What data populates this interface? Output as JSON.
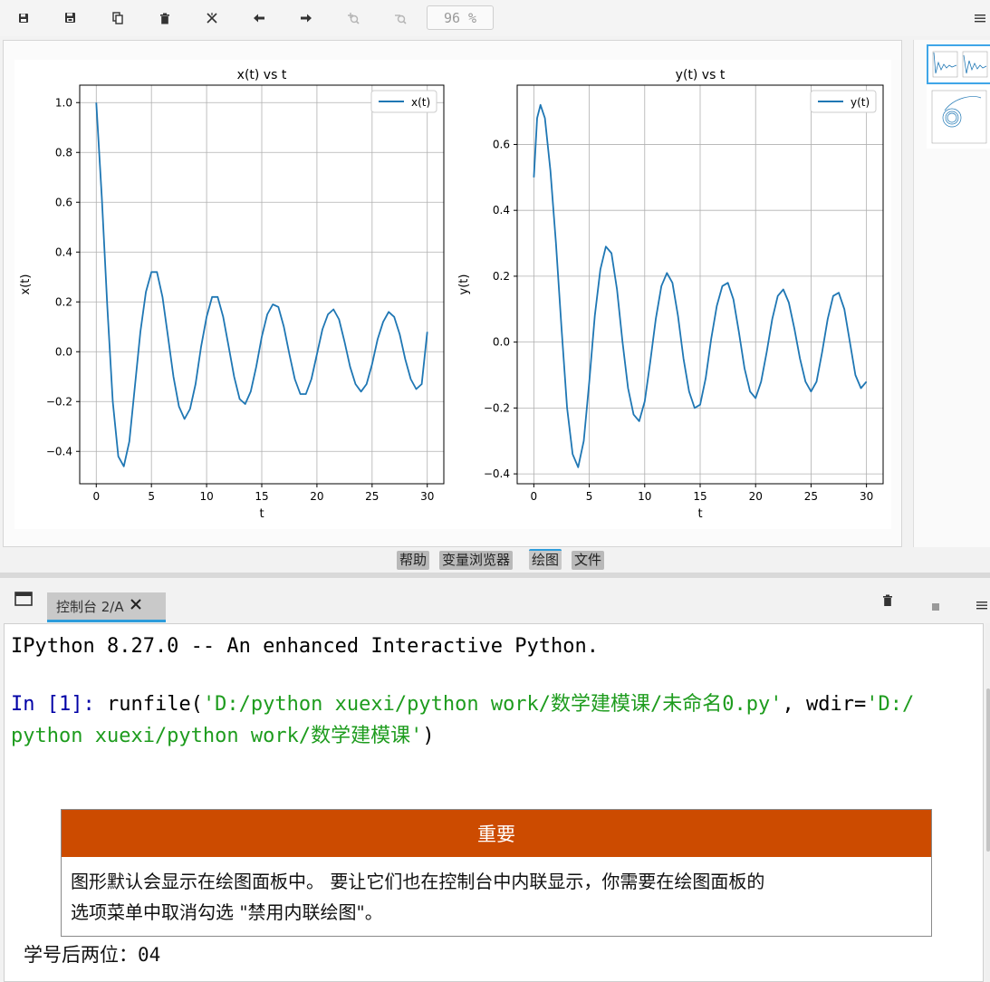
{
  "toolbar": {
    "zoom": "96 %",
    "icons": [
      "save-icon",
      "save-all-icon",
      "copy-icon",
      "delete-icon",
      "delete-all-icon",
      "back-arrow-icon",
      "forward-arrow-icon",
      "zoom-in-icon",
      "zoom-out-icon",
      "menu-icon"
    ]
  },
  "plugin_tabs": [
    "帮助",
    "变量浏览器",
    "绘图",
    "文件"
  ],
  "console": {
    "tab_label": "控制台 2/A",
    "banner": "IPython 8.27.0 -- An enhanced Interactive Python.",
    "prompt": "In [1]:",
    "cmd_func": "runfile(",
    "cmd_arg1": "'D:/python xuexi/python work/数学建模课/未命名0.py'",
    "cmd_sep": ", wdir=",
    "cmd_arg2a": "'D:/",
    "cmd_arg2b": "python xuexi/python work/数学建模课'",
    "cmd_close": ")",
    "callout_title": "重要",
    "callout_line1": "图形默认会显示在绘图面板中。 要让它们也在控制台中内联显示，你需要在绘图面板的",
    "callout_line2": "选项菜单中取消勾选 \"禁用内联绘图\"。",
    "output_label": "学号后两位：",
    "output_value": "04"
  },
  "chart_data": [
    {
      "type": "line",
      "title": "x(t) vs t",
      "xlabel": "t",
      "ylabel": "x(t)",
      "xlim": [
        -1.5,
        31.5
      ],
      "ylim": [
        -0.53,
        1.07
      ],
      "xticks": [
        0,
        5,
        10,
        15,
        20,
        25,
        30
      ],
      "yticks": [
        -0.4,
        -0.2,
        0.0,
        0.2,
        0.4,
        0.6,
        0.8,
        1.0
      ],
      "grid": true,
      "legend": "top-right",
      "series": [
        {
          "name": "x(t)",
          "color": "#1f77b4",
          "x": [
            0,
            0.5,
            1,
            1.5,
            2,
            2.5,
            3,
            3.5,
            4,
            4.5,
            5,
            5.5,
            6,
            6.5,
            7,
            7.5,
            8,
            8.5,
            9,
            9.5,
            10,
            10.5,
            11,
            11.5,
            12,
            12.5,
            13,
            13.5,
            14,
            14.5,
            15,
            15.5,
            16,
            16.5,
            17,
            17.5,
            18,
            18.5,
            19,
            19.5,
            20,
            20.5,
            21,
            21.5,
            22,
            22.5,
            23,
            23.5,
            24,
            24.5,
            25,
            25.5,
            26,
            26.5,
            27,
            27.5,
            28,
            28.5,
            29,
            29.5,
            30
          ],
          "y": [
            1.0,
            0.62,
            0.18,
            -0.2,
            -0.42,
            -0.46,
            -0.36,
            -0.14,
            0.08,
            0.24,
            0.32,
            0.32,
            0.22,
            0.06,
            -0.1,
            -0.22,
            -0.27,
            -0.23,
            -0.13,
            0.02,
            0.14,
            0.22,
            0.22,
            0.14,
            0.02,
            -0.1,
            -0.19,
            -0.21,
            -0.16,
            -0.06,
            0.06,
            0.15,
            0.19,
            0.18,
            0.1,
            -0.01,
            -0.11,
            -0.17,
            -0.17,
            -0.11,
            -0.01,
            0.09,
            0.15,
            0.17,
            0.13,
            0.04,
            -0.06,
            -0.13,
            -0.16,
            -0.13,
            -0.05,
            0.05,
            0.12,
            0.16,
            0.14,
            0.07,
            -0.03,
            -0.11,
            -0.15,
            -0.13,
            0.08
          ]
        }
      ]
    },
    {
      "type": "line",
      "title": "y(t) vs t",
      "xlabel": "t",
      "ylabel": "y(t)",
      "xlim": [
        -1.5,
        31.5
      ],
      "ylim": [
        -0.43,
        0.78
      ],
      "xticks": [
        0,
        5,
        10,
        15,
        20,
        25,
        30
      ],
      "yticks": [
        -0.4,
        -0.2,
        0.0,
        0.2,
        0.4,
        0.6
      ],
      "grid": true,
      "legend": "top-right",
      "series": [
        {
          "name": "y(t)",
          "color": "#1f77b4",
          "x": [
            0,
            0.3,
            0.6,
            1,
            1.5,
            2,
            2.5,
            3,
            3.5,
            4,
            4.5,
            5,
            5.5,
            6,
            6.5,
            7,
            7.5,
            8,
            8.5,
            9,
            9.5,
            10,
            10.5,
            11,
            11.5,
            12,
            12.5,
            13,
            13.5,
            14,
            14.5,
            15,
            15.5,
            16,
            16.5,
            17,
            17.5,
            18,
            18.5,
            19,
            19.5,
            20,
            20.5,
            21,
            21.5,
            22,
            22.5,
            23,
            23.5,
            24,
            24.5,
            25,
            25.5,
            26,
            26.5,
            27,
            27.5,
            28,
            28.5,
            29,
            29.5,
            30
          ],
          "y": [
            0.5,
            0.68,
            0.72,
            0.68,
            0.52,
            0.3,
            0.04,
            -0.2,
            -0.34,
            -0.38,
            -0.3,
            -0.12,
            0.08,
            0.22,
            0.29,
            0.27,
            0.16,
            0.0,
            -0.14,
            -0.22,
            -0.24,
            -0.18,
            -0.06,
            0.07,
            0.17,
            0.21,
            0.18,
            0.08,
            -0.05,
            -0.15,
            -0.2,
            -0.19,
            -0.11,
            0.01,
            0.11,
            0.17,
            0.18,
            0.13,
            0.03,
            -0.08,
            -0.15,
            -0.17,
            -0.12,
            -0.03,
            0.07,
            0.14,
            0.16,
            0.12,
            0.04,
            -0.05,
            -0.12,
            -0.15,
            -0.12,
            -0.03,
            0.07,
            0.14,
            0.15,
            0.1,
            0.0,
            -0.1,
            -0.14,
            -0.12
          ]
        }
      ]
    }
  ]
}
